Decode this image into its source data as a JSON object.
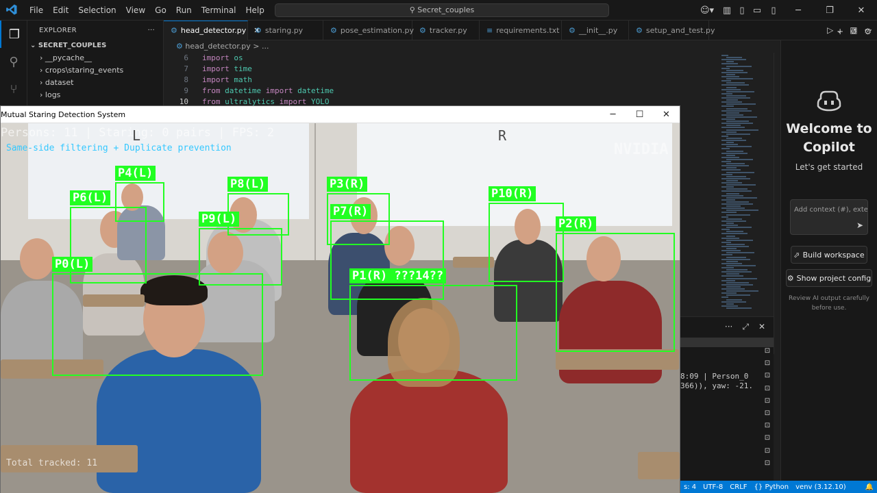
{
  "app": {
    "menu": [
      "File",
      "Edit",
      "Selection",
      "View",
      "Go",
      "Run",
      "Terminal",
      "Help"
    ],
    "search": "Secret_couples"
  },
  "explorer": {
    "header": "EXPLORER",
    "root": "SECRET_COUPLES",
    "items": [
      {
        "label": "__pycache__",
        "indent": 2,
        "chevron": "›"
      },
      {
        "label": "crops\\staring_events",
        "indent": 2,
        "chevron": "›"
      },
      {
        "label": "dataset",
        "indent": 2,
        "chevron": "›"
      },
      {
        "label": "logs",
        "indent": 2,
        "chevron": "›"
      }
    ]
  },
  "tabs": [
    {
      "label": "head_detector.py",
      "active": true
    },
    {
      "label": "staring.py",
      "active": false
    },
    {
      "label": "pose_estimation.py",
      "active": false
    },
    {
      "label": "tracker.py",
      "active": false
    },
    {
      "label": "requirements.txt",
      "active": false
    },
    {
      "label": "__init__.py",
      "active": false
    },
    {
      "label": "setup_and_test.py",
      "active": false
    }
  ],
  "breadcrumb": {
    "file": "head_detector.py",
    "rest": "> ..."
  },
  "code": [
    {
      "n": "6",
      "parts": [
        [
          "kw",
          "import "
        ],
        [
          "mod",
          "os"
        ]
      ]
    },
    {
      "n": "7",
      "parts": [
        [
          "kw",
          "import "
        ],
        [
          "mod",
          "time"
        ]
      ]
    },
    {
      "n": "8",
      "parts": [
        [
          "kw",
          "import "
        ],
        [
          "mod",
          "math"
        ]
      ]
    },
    {
      "n": "9",
      "parts": [
        [
          "kw",
          "from "
        ],
        [
          "mod",
          "datetime "
        ],
        [
          "kw",
          "import "
        ],
        [
          "mod",
          "datetime"
        ]
      ]
    },
    {
      "n": "10",
      "parts": [
        [
          "kw",
          "from "
        ],
        [
          "mod",
          "ultralytics "
        ],
        [
          "kw",
          "import "
        ],
        [
          "mod",
          "YOLO"
        ]
      ]
    }
  ],
  "copilot": {
    "title": "Welcome to Copilot",
    "subtitle": "Let's get started",
    "input_placeholder": "Add context (#), exter",
    "build_button": "Build workspace",
    "config_button": "Show project config",
    "note": "Review AI output carefully before use."
  },
  "terminal": {
    "lines": [
      "8:09 | Person_0",
      "366)), yaw: -21."
    ]
  },
  "status": {
    "items": [
      "s: 4",
      "UTF-8",
      "CRLF",
      "{} Python",
      "venv (3.12.10)"
    ]
  },
  "cv_window": {
    "title": "Mutual Staring Detection System",
    "hud_line1": "Persons: 11 | Staring: 0 pairs | FPS: 2",
    "hud_line2": "Same-side filtering + Duplicate prevention",
    "left_marker": "L",
    "right_marker": "R",
    "watermark": "NVIDIA",
    "footer": "Total tracked: 11",
    "detections": [
      {
        "label": "P4(L)"
      },
      {
        "label": "P6(L)"
      },
      {
        "label": "P8(L)"
      },
      {
        "label": "P9(L)"
      },
      {
        "label": "P0(L)"
      },
      {
        "label": "P3(R)"
      },
      {
        "label": "P7(R)"
      },
      {
        "label": "P10(R)"
      },
      {
        "label": "P2(R)"
      },
      {
        "label": "P1(R) ???14??"
      }
    ],
    "box_color": "#22ff22"
  },
  "colors": {
    "accent": "#0078d4",
    "status_bg": "#0078d4"
  }
}
